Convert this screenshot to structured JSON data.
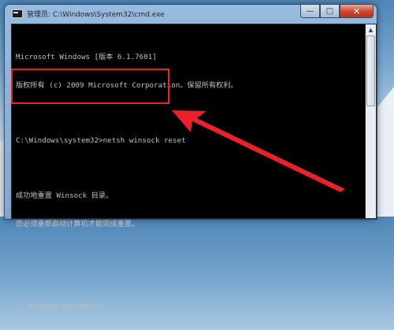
{
  "window": {
    "title": "管理员: C:\\Windows\\System32\\cmd.exe",
    "minimize_label": "—",
    "maximize_label": "□",
    "close_label": "✕",
    "icon": "cmd-icon"
  },
  "console": {
    "lines": [
      "Microsoft Windows [版本 6.1.7601]",
      "版权所有 (c) 2009 Microsoft Corporation。保留所有权利。",
      "",
      "C:\\Windows\\system32>netsh winsock reset",
      "",
      "成功地重置 Winsock 目录。",
      "您必须重新启动计算机才能完成重置。",
      "",
      "",
      "C:\\Windows\\system32>"
    ]
  },
  "annotation": {
    "highlight_color": "#e8212a",
    "arrow_color": "#e8212a"
  }
}
